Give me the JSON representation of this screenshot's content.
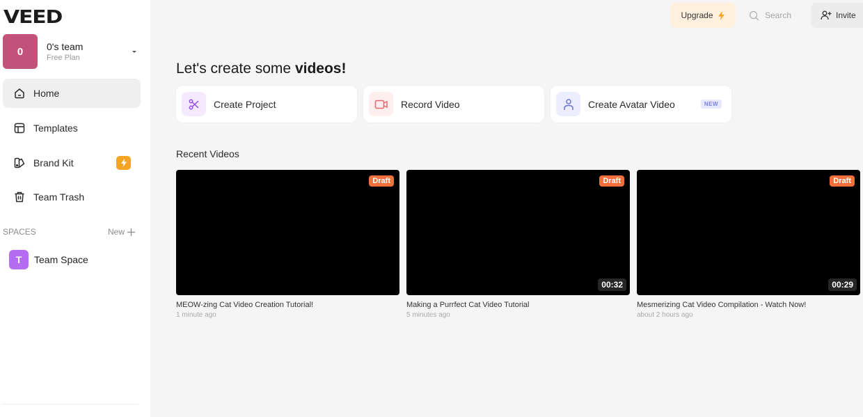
{
  "brand": {
    "logo": "VEED"
  },
  "team": {
    "initial": "0",
    "name": "0's team",
    "plan": "Free Plan",
    "avatar_color": "#c1537a"
  },
  "sidebar": {
    "items": [
      {
        "label": "Home",
        "icon": "home-icon",
        "active": true
      },
      {
        "label": "Templates",
        "icon": "templates-icon",
        "active": false
      },
      {
        "label": "Brand Kit",
        "icon": "brand-kit-icon",
        "active": false,
        "badge": "lightning-icon"
      },
      {
        "label": "Team Trash",
        "icon": "trash-icon",
        "active": false
      }
    ],
    "spaces_header": "SPACES",
    "spaces_new": "New",
    "spaces": [
      {
        "initial": "T",
        "label": "Team Space",
        "color": "#b56cf2"
      }
    ]
  },
  "topbar": {
    "upgrade": "Upgrade",
    "search_placeholder": "Search",
    "invite": "Invite"
  },
  "main": {
    "title_regular": "Let's create some ",
    "title_bold": "videos!",
    "actions": [
      {
        "label": "Create Project",
        "icon": "scissors-icon"
      },
      {
        "label": "Record Video",
        "icon": "video-camera-icon"
      },
      {
        "label": "Create Avatar Video",
        "icon": "user-icon",
        "badge": "NEW"
      }
    ],
    "recent_title": "Recent Videos",
    "videos": [
      {
        "title": "MEOW-zing Cat Video Creation Tutorial!",
        "time": "1 minute ago",
        "status": "Draft",
        "duration": ""
      },
      {
        "title": "Making a Purrfect Cat Video Tutorial",
        "time": "5 minutes ago",
        "status": "Draft",
        "duration": "00:32"
      },
      {
        "title": "Mesmerizing Cat Video Compilation - Watch Now!",
        "time": "about 2 hours ago",
        "status": "Draft",
        "duration": "00:29"
      }
    ]
  },
  "colors": {
    "accent_orange": "#f16f3a",
    "upgrade_bg": "#fff1de",
    "badge_yellow": "#f5a524"
  }
}
